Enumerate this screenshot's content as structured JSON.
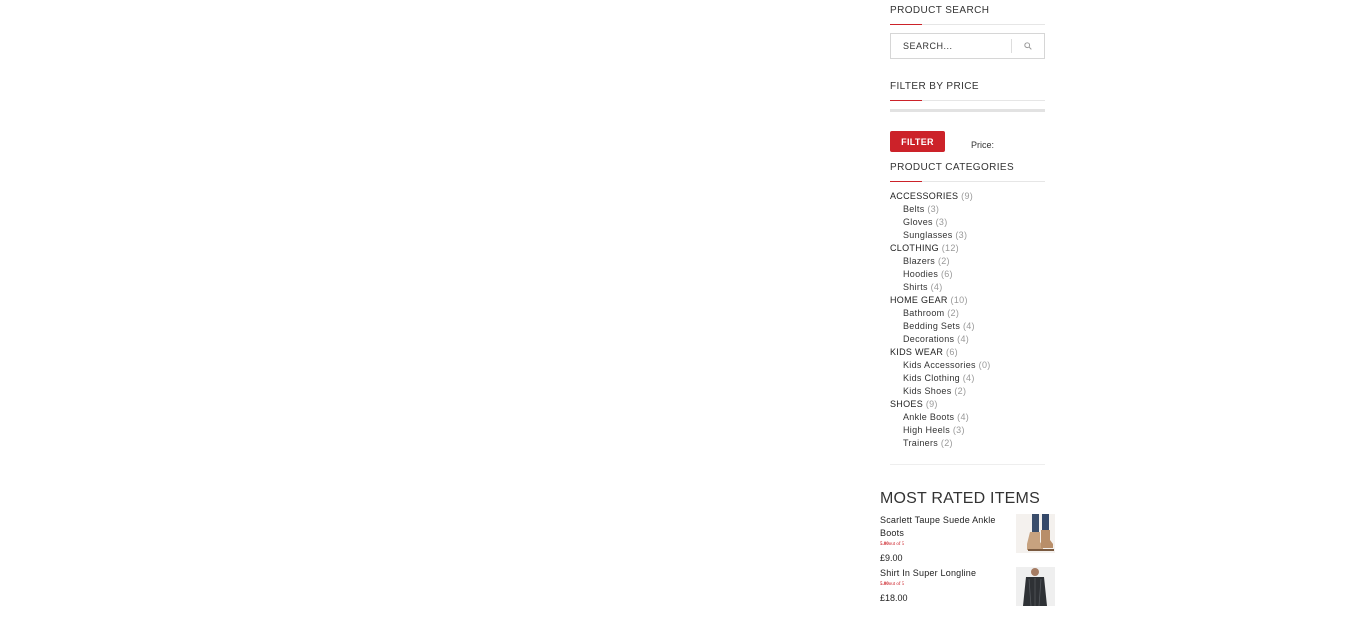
{
  "product_search": {
    "title": "PRODUCT SEARCH",
    "placeholder": "SEARCH...",
    "button_icon": "search-icon"
  },
  "filter_by_price": {
    "title": "FILTER BY PRICE",
    "button_label": "FILTER",
    "price_label": "Price:"
  },
  "product_categories": {
    "title": "PRODUCT CATEGORIES",
    "items": [
      {
        "label": "ACCESSORIES",
        "count": "(9)",
        "children": [
          {
            "label": "Belts",
            "count": "(3)"
          },
          {
            "label": "Gloves",
            "count": "(3)"
          },
          {
            "label": "Sunglasses",
            "count": "(3)"
          }
        ]
      },
      {
        "label": "CLOTHING",
        "count": "(12)",
        "children": [
          {
            "label": "Blazers",
            "count": "(2)"
          },
          {
            "label": "Hoodies",
            "count": "(6)"
          },
          {
            "label": "Shirts",
            "count": "(4)"
          }
        ]
      },
      {
        "label": "HOME GEAR",
        "count": "(10)",
        "children": [
          {
            "label": "Bathroom",
            "count": "(2)"
          },
          {
            "label": "Bedding Sets",
            "count": "(4)"
          },
          {
            "label": "Decorations",
            "count": "(4)"
          }
        ]
      },
      {
        "label": "KIDS WEAR",
        "count": "(6)",
        "children": [
          {
            "label": "Kids Accessories",
            "count": "(0)"
          },
          {
            "label": "Kids Clothing",
            "count": "(4)"
          },
          {
            "label": "Kids Shoes",
            "count": "(2)"
          }
        ]
      },
      {
        "label": "SHOES",
        "count": "(9)",
        "children": [
          {
            "label": "Ankle Boots",
            "count": "(4)"
          },
          {
            "label": "High Heels",
            "count": "(3)"
          },
          {
            "label": "Trainers",
            "count": "(2)"
          }
        ]
      }
    ]
  },
  "most_rated": {
    "title": "MOST RATED ITEMS",
    "products": [
      {
        "name": "Scarlett Taupe Suede Ankle Boots",
        "rating_value": "5.00",
        "rating_suffix": "out of 5",
        "price": "£9.00",
        "thumb_icon": "ankle-boots-thumbnail"
      },
      {
        "name": "Shirt In Super Longline",
        "rating_value": "5.00",
        "rating_suffix": "out of 5",
        "price": "£18.00",
        "thumb_icon": "longline-shirt-thumbnail"
      }
    ]
  },
  "colors": {
    "accent": "#cc2229",
    "text": "#333333",
    "muted": "#999999",
    "border": "#d6d6d6"
  }
}
